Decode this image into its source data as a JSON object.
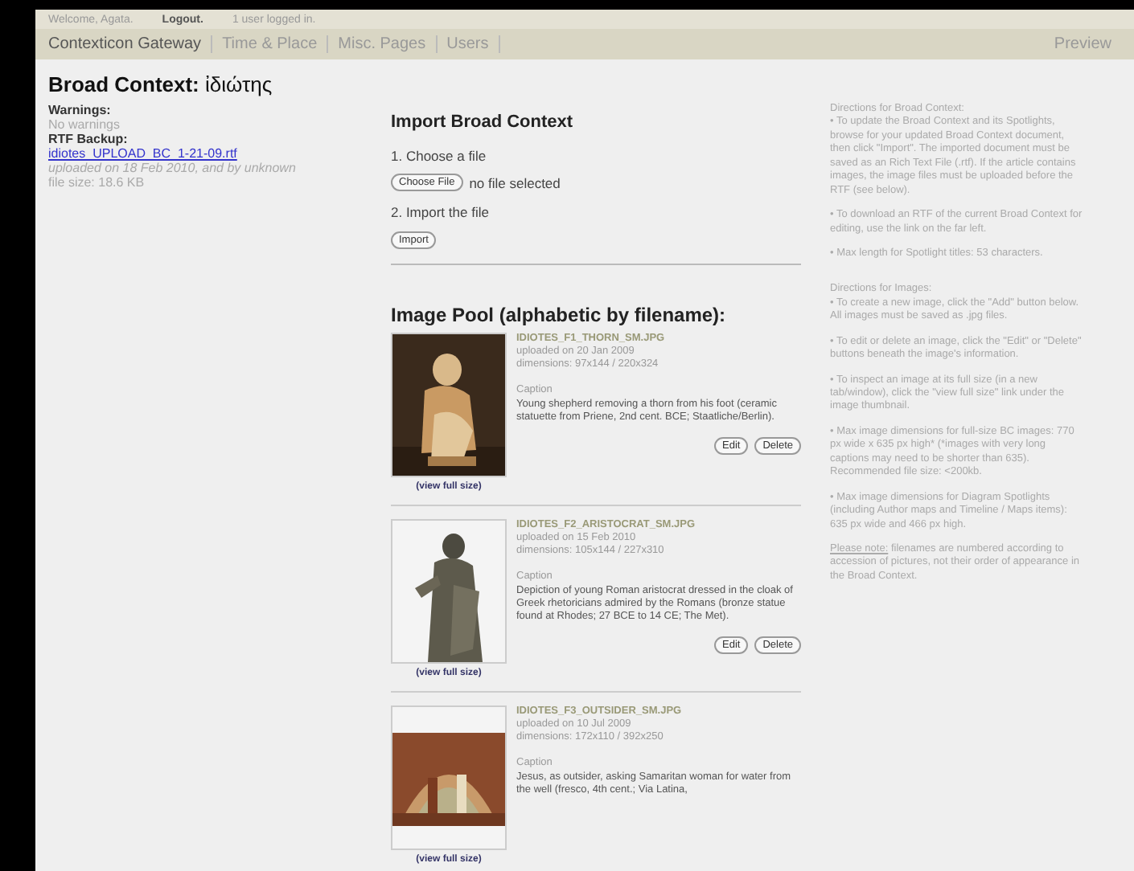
{
  "top_bar": {
    "welcome": "Welcome, Agata.",
    "logout": "Logout.",
    "users_online": "1 user logged in."
  },
  "nav": {
    "items": [
      {
        "label": "Contexticon Gateway",
        "selected": true
      },
      {
        "label": "Time & Place",
        "selected": false
      },
      {
        "label": "Misc. Pages",
        "selected": false
      },
      {
        "label": "Users",
        "selected": false
      }
    ],
    "preview": "Preview"
  },
  "title": {
    "label": "Broad Context:",
    "value": "ἰδιώτης"
  },
  "sidebar": {
    "warnings_label": "Warnings:",
    "warnings": "No warnings",
    "backup_label": "RTF Backup:",
    "backup_link": "idiotes_UPLOAD_BC_1-21-09.rtf",
    "uploaded": "uploaded on 18 Feb 2010, and by unknown",
    "file_size": "file size: 18.6 KB"
  },
  "import": {
    "heading": "Import Broad Context",
    "step1": "1. Choose a file",
    "choose_button": "Choose File",
    "no_file": "no file selected",
    "step2": "2. Import the file",
    "import_button": "Import"
  },
  "image_pool": {
    "heading": "Image Pool (alphabetic by filename):",
    "items": [
      {
        "kind": "picture",
        "view_link": "(view full size)",
        "filename": "IDIOTES_F1_THORN_SM.JPG",
        "uploaded": "uploaded on 20 Jan 2009",
        "dimensions": "dimensions: 97x144 / 220x324",
        "caption_label": "Caption",
        "caption": "Young shepherd removing a thorn from his foot (ceramic statuette from Priene, 2nd cent. BCE; Staatliche/Berlin).",
        "buttons": [
          "Edit",
          "Delete"
        ]
      },
      {
        "kind": "picture",
        "view_link": "(view full size)",
        "filename": "IDIOTES_F2_ARISTOCRAT_SM.JPG",
        "uploaded": "uploaded on 15 Feb 2010",
        "dimensions": "dimensions: 105x144 / 227x310",
        "caption_label": "Caption",
        "caption": "Depiction of young Roman aristocrat dressed in the cloak of Greek rhetoricians admired by the Romans (bronze statue found at Rhodes; 27 BCE to 14 CE; The Met).",
        "buttons": [
          "Edit",
          "Delete"
        ]
      },
      {
        "kind": "picture",
        "view_link": "(view full size)",
        "filename": "IDIOTES_F3_OUTSIDER_SM.JPG",
        "uploaded": "uploaded on 10 Jul 2009",
        "dimensions": "dimensions: 172x110 / 392x250",
        "caption_label": "Caption",
        "caption": "Jesus, as outsider, asking Samaritan woman for water from the well (fresco, 4th cent.; Via Latina,"
      }
    ]
  },
  "directions": {
    "paragraphs": [
      "Directions for Broad Context:\n• To update the Broad Context and its Spotlights, browse for your updated Broad Context document, then click \"Import\". The imported document must be saved as an Rich Text File (.rtf). If the article contains images, the image files must be uploaded before the RTF (see below).",
      "• To download an RTF of the current Broad Context for editing, use the link on the far left.",
      "• Max length for Spotlight titles: 53 characters."
    ],
    "image_paragraphs": [
      "Directions for Images:\n• To create a new image, click the \"Add\" button below. All images must be saved as .jpg files.",
      "• To edit or delete an image, click the \"Edit\" or \"Delete\" buttons beneath the image's information.",
      "• To inspect an image at its full size (in a new tab/window), click the \"view full size\" link under the image thumbnail.",
      "• Max image dimensions for full-size BC images: 770 px wide x 635 px high* (*images with very long captions may need to be shorter than 635). Recommended file size: <200kb.",
      "• Max image dimensions for Diagram Spotlights (including Author maps and Timeline / Maps items): 635 px wide and 466 px high."
    ],
    "note_label": "Please note:",
    "note": "filenames are numbered according to accession of pictures, not their order of appearance in the Broad Context."
  }
}
